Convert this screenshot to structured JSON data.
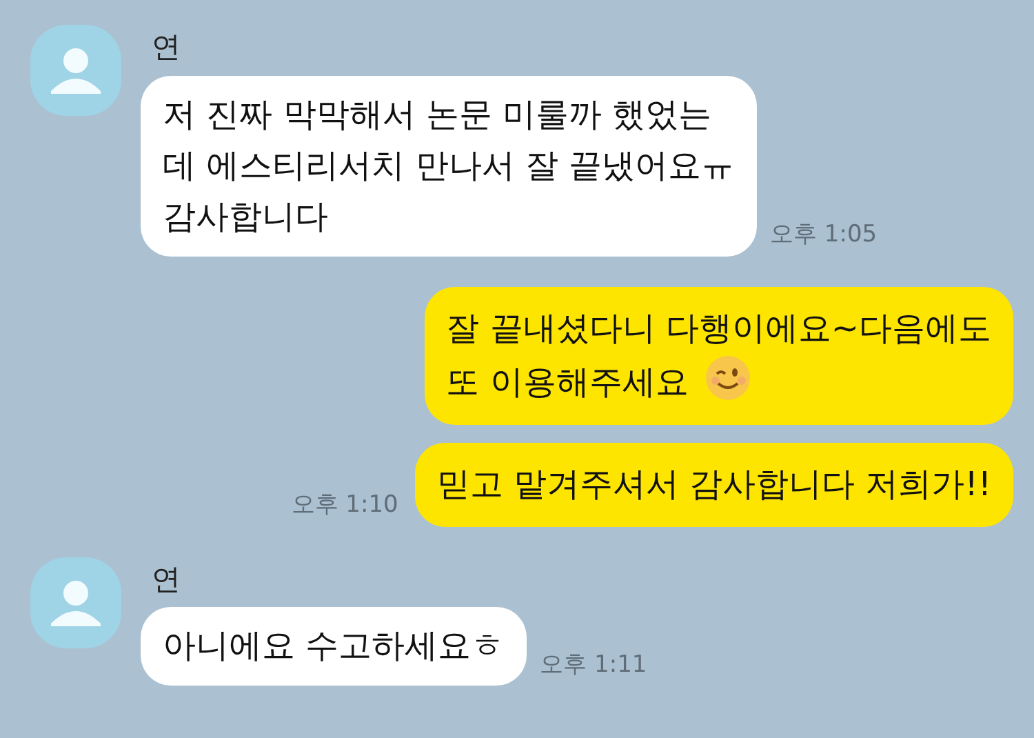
{
  "messages": [
    {
      "kind": "received",
      "sender": "연",
      "text": "저 진짜 막막해서 논문 미룰까 했었는\n데 에스티리서치 만나서 잘 끝냈어요ㅠ\n감사합니다",
      "time": "오후 1:05"
    },
    {
      "kind": "sent",
      "text": "잘 끝내셨다니 다행이에요~다음에도\n또 이용해주세요",
      "winking_emoji": true
    },
    {
      "kind": "sent",
      "text": "믿고 맡겨주셔서 감사합니다 저희가!!",
      "time": "오후 1:10"
    },
    {
      "kind": "received",
      "sender": "연",
      "text": "아니에요 수고하세요ㅎ",
      "time": "오후 1:11"
    }
  ]
}
